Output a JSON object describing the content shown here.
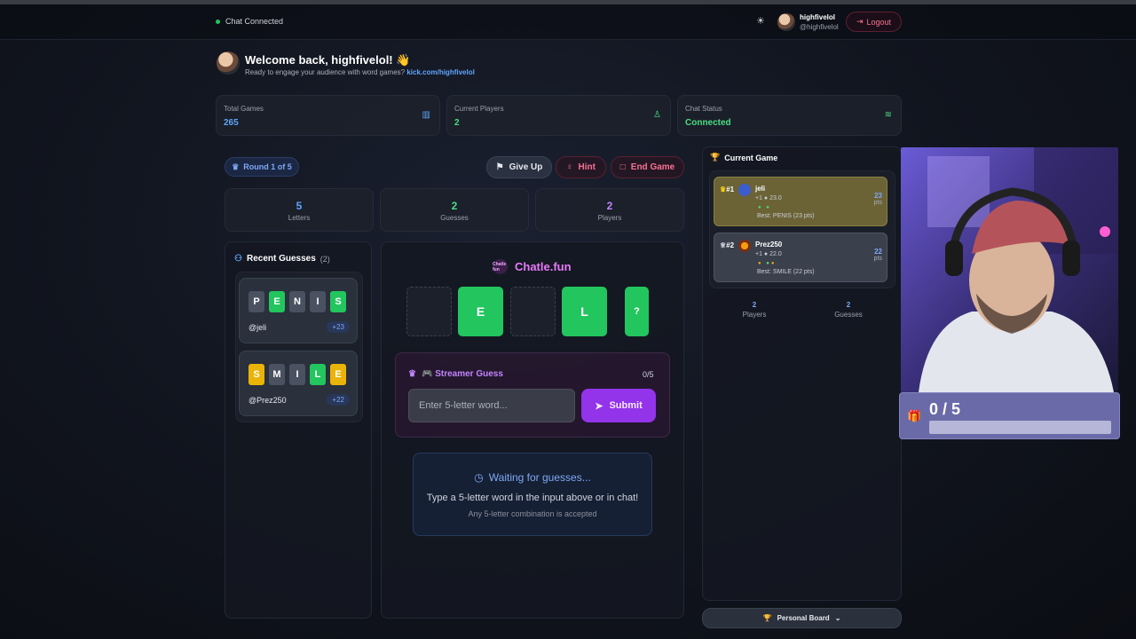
{
  "header": {
    "chat_status": "Chat Connected",
    "user_name": "highfivelol",
    "user_handle": "@highfivelol",
    "logout_label": "Logout"
  },
  "welcome": {
    "title": "Welcome back, highfivelol! 👋",
    "subtitle": "Ready to engage your audience with word games?",
    "link": "kick.com/highfivelol"
  },
  "stats": [
    {
      "label": "Total Games",
      "value": "265",
      "color": "#60a5fa",
      "icon": "bar-chart-icon"
    },
    {
      "label": "Current Players",
      "value": "2",
      "color": "#4ade80",
      "icon": "user-icon"
    },
    {
      "label": "Chat Status",
      "value": "Connected",
      "color": "#4ade80",
      "icon": "wifi-icon"
    }
  ],
  "game": {
    "round_label": "Round 1 of 5",
    "give_up": "Give Up",
    "hint": "Hint",
    "end_game": "End Game",
    "mini": [
      {
        "value": "5",
        "label": "Letters",
        "color": "#60a5fa"
      },
      {
        "value": "2",
        "label": "Guesses",
        "color": "#4ade80"
      },
      {
        "value": "2",
        "label": "Players",
        "color": "#c084fc"
      }
    ],
    "brand_logo": "Chatle fun",
    "brand": "Chatle.fun",
    "board": [
      "",
      "E",
      "",
      "L",
      "?"
    ]
  },
  "recent_guesses": {
    "title": "Recent Guesses",
    "count": "(2)",
    "items": [
      {
        "letters": [
          "P",
          "E",
          "N",
          "I",
          "S"
        ],
        "colors": [
          "gray",
          "green",
          "gray",
          "gray",
          "green"
        ],
        "user": "@jeli",
        "points": "+23"
      },
      {
        "letters": [
          "S",
          "M",
          "I",
          "L",
          "E"
        ],
        "colors": [
          "yellow",
          "gray",
          "gray",
          "green",
          "yellow"
        ],
        "user": "@Prez250",
        "points": "+22"
      }
    ]
  },
  "streamer_guess": {
    "title": "🎮 Streamer Guess",
    "count": "0/5",
    "placeholder": "Enter 5-letter word...",
    "submit": "Submit"
  },
  "waiting": {
    "title": "Waiting for guesses...",
    "line1": "Type a 5-letter word in the input above or in chat!",
    "line2": "Any 5-letter combination is accepted"
  },
  "current_game": {
    "title": "Current Game",
    "players": [
      {
        "rank": "#1",
        "name": "jeli",
        "meta": "+1 ● 23.0",
        "best": "Best: PENIS (23 pts)",
        "points": "23",
        "unit": "pts"
      },
      {
        "rank": "#2",
        "name": "Prez250",
        "meta": "+1 ● 22.0",
        "best": "Best: SMILE (22 pts)",
        "points": "22",
        "unit": "pts"
      }
    ],
    "players_count": "2",
    "players_label": "Players",
    "guesses_count": "2",
    "guesses_label": "Guesses",
    "personal_board": "Personal Board"
  },
  "overlay": {
    "progress_text": "0 / 5",
    "progress_fraction": 0
  }
}
